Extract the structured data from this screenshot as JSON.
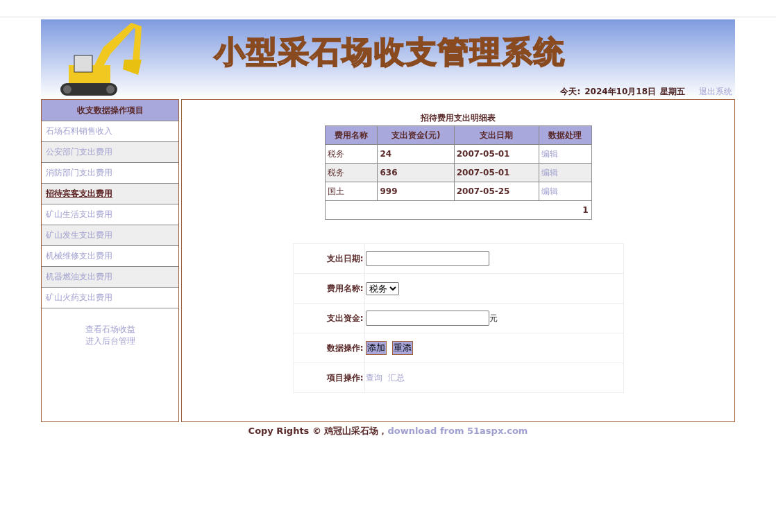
{
  "header": {
    "title": "小型采石场收支管理系统",
    "date_label": "今天:",
    "date": "2024年10月18日",
    "weekday": "星期五",
    "logout": "退出系统"
  },
  "sidebar": {
    "heading": "收支数据操作项目",
    "items": [
      {
        "label": "石场石料销售收入",
        "selected": false
      },
      {
        "label": "公安部门支出费用",
        "selected": false
      },
      {
        "label": "消防部门支出费用",
        "selected": false
      },
      {
        "label": "招待宾客支出费用",
        "selected": true
      },
      {
        "label": "矿山生活支出费用",
        "selected": false
      },
      {
        "label": "矿山发生支出费用",
        "selected": false
      },
      {
        "label": "机械维修支出费用",
        "selected": false
      },
      {
        "label": "机器燃油支出费用",
        "selected": false
      },
      {
        "label": "矿山火药支出费用",
        "selected": false
      }
    ],
    "links": [
      "查看石场收益",
      "进入后台管理"
    ]
  },
  "table": {
    "title": "招待费用支出明细表",
    "columns": [
      "费用名称",
      "支出资金(元)",
      "支出日期",
      "数据处理"
    ],
    "rows": [
      {
        "name": "税务",
        "amount": "24",
        "date": "2007-05-01",
        "action": "编辑"
      },
      {
        "name": "税务",
        "amount": "636",
        "date": "2007-05-01",
        "action": "编辑"
      },
      {
        "name": "国土",
        "amount": "999",
        "date": "2007-05-25",
        "action": "编辑"
      }
    ],
    "pager": "1"
  },
  "form": [
    {
      "kind": "date",
      "label": "支出日期:"
    },
    {
      "kind": "select",
      "label": "费用名称:",
      "value": "税务"
    },
    {
      "kind": "money",
      "label": "支出资金:",
      "unit": "元"
    },
    {
      "kind": "buttons",
      "label": "数据操作:",
      "buttons": [
        "添加",
        "重添"
      ]
    },
    {
      "kind": "links",
      "label": "项目操作:",
      "links": [
        "查询",
        "汇总"
      ]
    }
  ],
  "footer": {
    "text": "Copy Rights © 鸡冠山采石场，",
    "link": "download from 51aspx.com"
  }
}
